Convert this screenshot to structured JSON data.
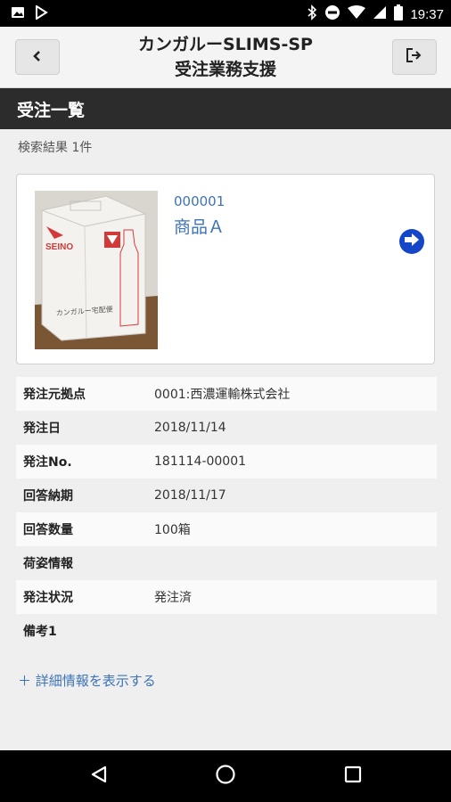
{
  "status_bar": {
    "time": "19:37",
    "icons": [
      "image-icon",
      "play-store-icon",
      "bluetooth-icon",
      "do-not-disturb-icon",
      "wifi-icon",
      "signal-icon",
      "battery-icon"
    ]
  },
  "header": {
    "title_line1": "カンガルーSLIMS-SP",
    "title_line2": "受注業務支援",
    "back_icon": "chevron-left-icon",
    "logout_icon": "logout-icon"
  },
  "section": {
    "title": "受注一覧"
  },
  "search": {
    "result_text": "検索結果 1件"
  },
  "product": {
    "code": "000001",
    "name": "商品Ａ",
    "image_brand": "SEINO",
    "image_box_text": "カンガルー宅配便"
  },
  "details": [
    {
      "label": "発注元拠点",
      "value": "0001:西濃運輸株式会社"
    },
    {
      "label": "発注日",
      "value": "2018/11/14"
    },
    {
      "label": "発注No.",
      "value": "181114-00001"
    },
    {
      "label": "回答納期",
      "value": "2018/11/17"
    },
    {
      "label": "回答数量",
      "value": "100箱"
    },
    {
      "label": "荷姿情報",
      "value": ""
    },
    {
      "label": "発注状況",
      "value": "発注済"
    },
    {
      "label": "備考1",
      "value": ""
    }
  ],
  "more_link": "＋ 詳細情報を表示する",
  "colors": {
    "link": "#3d73b8",
    "section_bar": "#2c2c2c",
    "arrow_button": "#1646c8"
  }
}
